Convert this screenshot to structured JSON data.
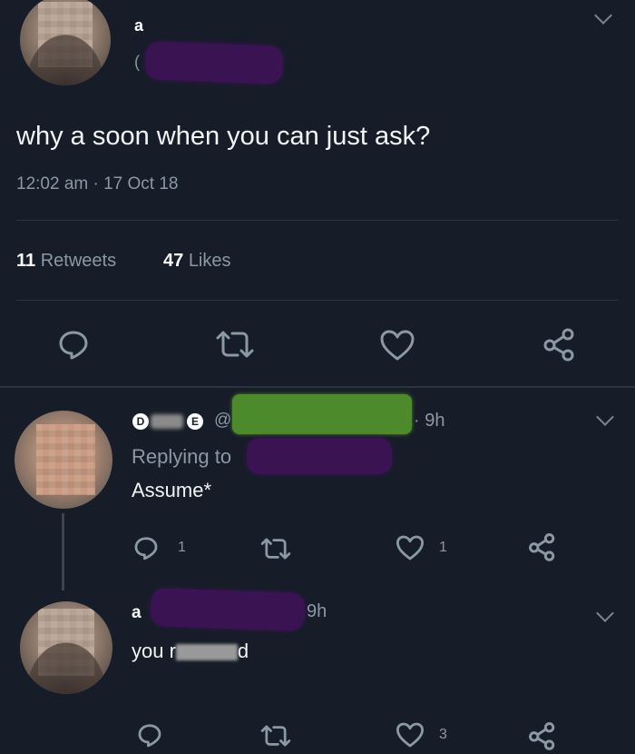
{
  "tweet": {
    "author_name": "a",
    "handle_prefix": "(",
    "text": "why a soon when you can just ask?",
    "timestamp": "12:02 am · 17 Oct 18",
    "retweets_count": "11",
    "retweets_label": "Retweets",
    "likes_count": "47",
    "likes_label": "Likes"
  },
  "reply1": {
    "name_badge_1": "D",
    "name_badge_2": "E",
    "handle_prefix": "@",
    "time": "· 9h",
    "replying_to_label": "Replying to",
    "text": "Assume*",
    "reply_count": "1",
    "like_count": "1"
  },
  "reply2": {
    "author_name": "a",
    "time": "9h",
    "text_start": "you r",
    "text_end": "d",
    "like_count": "3"
  },
  "icons": {
    "reply": "reply-icon",
    "retweet": "retweet-icon",
    "like": "heart-icon",
    "share": "share-icon",
    "more": "chevron-down-icon"
  },
  "colors": {
    "background": "#161d28",
    "text": "#e8ecf0",
    "muted": "#8b98a5",
    "redact_purple": "#3a1352",
    "redact_green": "#4c8a2b"
  }
}
